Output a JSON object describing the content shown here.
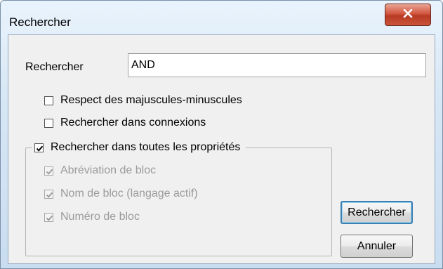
{
  "dialog": {
    "title": "Rechercher",
    "close_symbol": "X"
  },
  "search": {
    "label": "Rechercher",
    "value": "AND"
  },
  "options": {
    "case_sensitive": {
      "label": "Respect des majuscules-minuscules",
      "checked": false
    },
    "search_connections": {
      "label": "Rechercher dans connexions",
      "checked": false
    },
    "search_all_properties": {
      "label": "Rechercher dans toutes les propriétés",
      "checked": true
    }
  },
  "property_options": [
    {
      "label": "Abréviation de bloc",
      "checked": true,
      "enabled": false
    },
    {
      "label": "Nom de bloc (langage actif)",
      "checked": true,
      "enabled": false
    },
    {
      "label": "Numéro de bloc",
      "checked": true,
      "enabled": false
    }
  ],
  "buttons": {
    "search_label": "Rechercher",
    "cancel_label": "Annuler"
  },
  "colors": {
    "close_button": "#c9553a",
    "default_button_border": "#3c7fb1",
    "disabled_text": "#9b9b9b"
  }
}
